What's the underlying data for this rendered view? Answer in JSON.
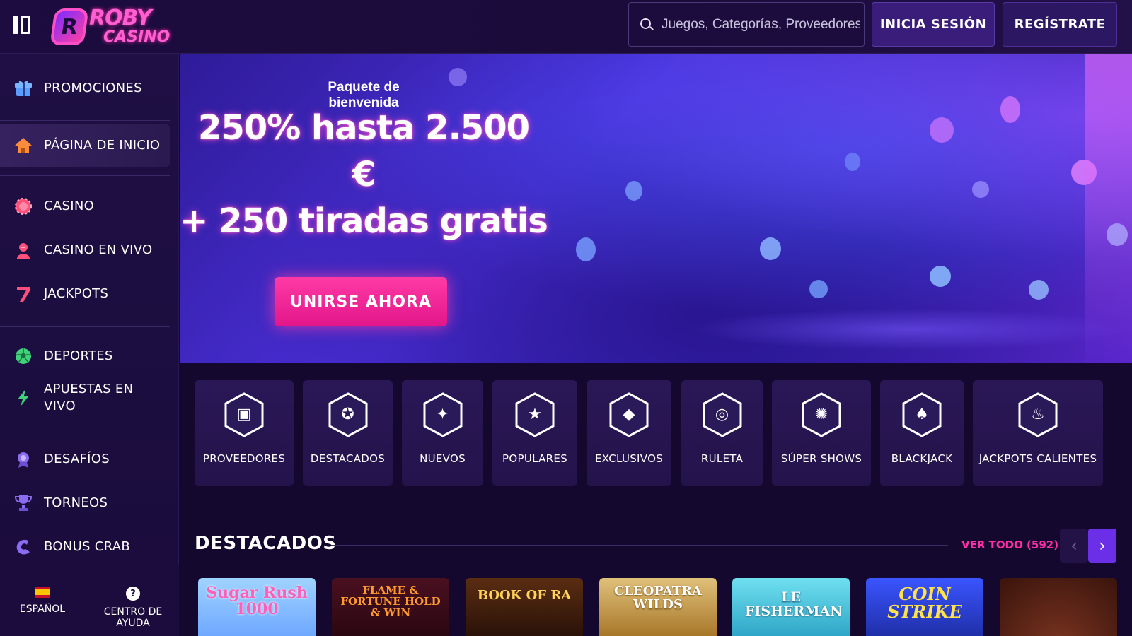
{
  "header": {
    "logo_line1": "ROBY",
    "logo_line2": "CASINO",
    "logo_badge": "R",
    "search_placeholder": "Juegos, Categorías, Proveedores",
    "login_label": "INICIA SESIÓN",
    "register_label": "REGÍSTRATE"
  },
  "sidebar": {
    "items": [
      {
        "label": "PROMOCIONES",
        "icon": "gift-icon",
        "color": "#5a9cff"
      },
      {
        "label": "PÁGINA DE INICIO",
        "icon": "home-icon",
        "color": "#ff8c3a",
        "active": true
      },
      {
        "label": "CASINO",
        "icon": "casino-chip-icon",
        "color": "#ff4f7b"
      },
      {
        "label": "CASINO EN VIVO",
        "icon": "live-dealer-icon",
        "color": "#ff4f7b"
      },
      {
        "label": "JACKPOTS",
        "icon": "seven-icon",
        "color": "#ff4f7b"
      },
      {
        "label": "DEPORTES",
        "icon": "soccer-ball-icon",
        "color": "#3fd27b"
      },
      {
        "label": "APUESTAS EN VIVO",
        "icon": "lightning-icon",
        "color": "#3fd27b"
      },
      {
        "label": "DESAFÍOS",
        "icon": "medal-icon",
        "color": "#8a6cf0"
      },
      {
        "label": "TORNEOS",
        "icon": "trophy-icon",
        "color": "#8a6cf0"
      },
      {
        "label": "BONUS CRAB",
        "icon": "claw-icon",
        "color": "#8a6cf0"
      }
    ],
    "language_label": "ESPAÑOL",
    "help_label": "CENTRO DE AYUDA",
    "help_glyph": "?"
  },
  "hero": {
    "subtitle": "Paquete de bienvenida",
    "title_line1": "250% hasta 2.500",
    "title_line2": "€",
    "title_line3": "+ 250 tiradas gratis",
    "cta_label": "UNIRSE AHORA"
  },
  "categories": [
    {
      "label": "PROVEEDORES",
      "icon": "folder-icon",
      "glyph": "▣"
    },
    {
      "label": "DESTACADOS",
      "icon": "award-ribbon-icon",
      "glyph": "✪"
    },
    {
      "label": "NUEVOS",
      "icon": "sparkle-icon",
      "glyph": "✦"
    },
    {
      "label": "POPULARES",
      "icon": "star-icon",
      "glyph": "★"
    },
    {
      "label": "EXCLUSIVOS",
      "icon": "diamond-icon",
      "glyph": "◆"
    },
    {
      "label": "RULETA",
      "icon": "roulette-icon",
      "glyph": "◎"
    },
    {
      "label": "SÚPER SHOWS",
      "icon": "wheel-icon",
      "glyph": "✺"
    },
    {
      "label": "BLACKJACK",
      "icon": "spade-icon",
      "glyph": "♠"
    },
    {
      "label": "JACKPOTS CALIENTES",
      "icon": "flame-icon",
      "glyph": "♨"
    }
  ],
  "featured": {
    "title": "DESTACADOS",
    "see_all": "VER TODO (592)",
    "prev": "‹",
    "next": "›",
    "games": [
      {
        "title": "Sugar Rush 1000",
        "bg": "#8fc6ff",
        "fg": "#ff5fb7"
      },
      {
        "title": "FLAME & FORTUNE HOLD & WIN",
        "bg": "#3a0d1c",
        "fg": "#ff9a2e"
      },
      {
        "title": "BOOK OF RA",
        "bg": "#3b1f10",
        "fg": "#ffd35a"
      },
      {
        "title": "CLEOPATRA WILDS",
        "bg": "#c89a3c",
        "fg": "#ffffff"
      },
      {
        "title": "LE FISHERMAN",
        "bg": "#4fc6e0",
        "fg": "#ffffff"
      },
      {
        "title": "COIN STRIKE",
        "bg": "#2b3fd1",
        "fg": "#ffe14a"
      },
      {
        "title": "",
        "bg": "#5a2417",
        "fg": "#ffffff"
      }
    ]
  }
}
